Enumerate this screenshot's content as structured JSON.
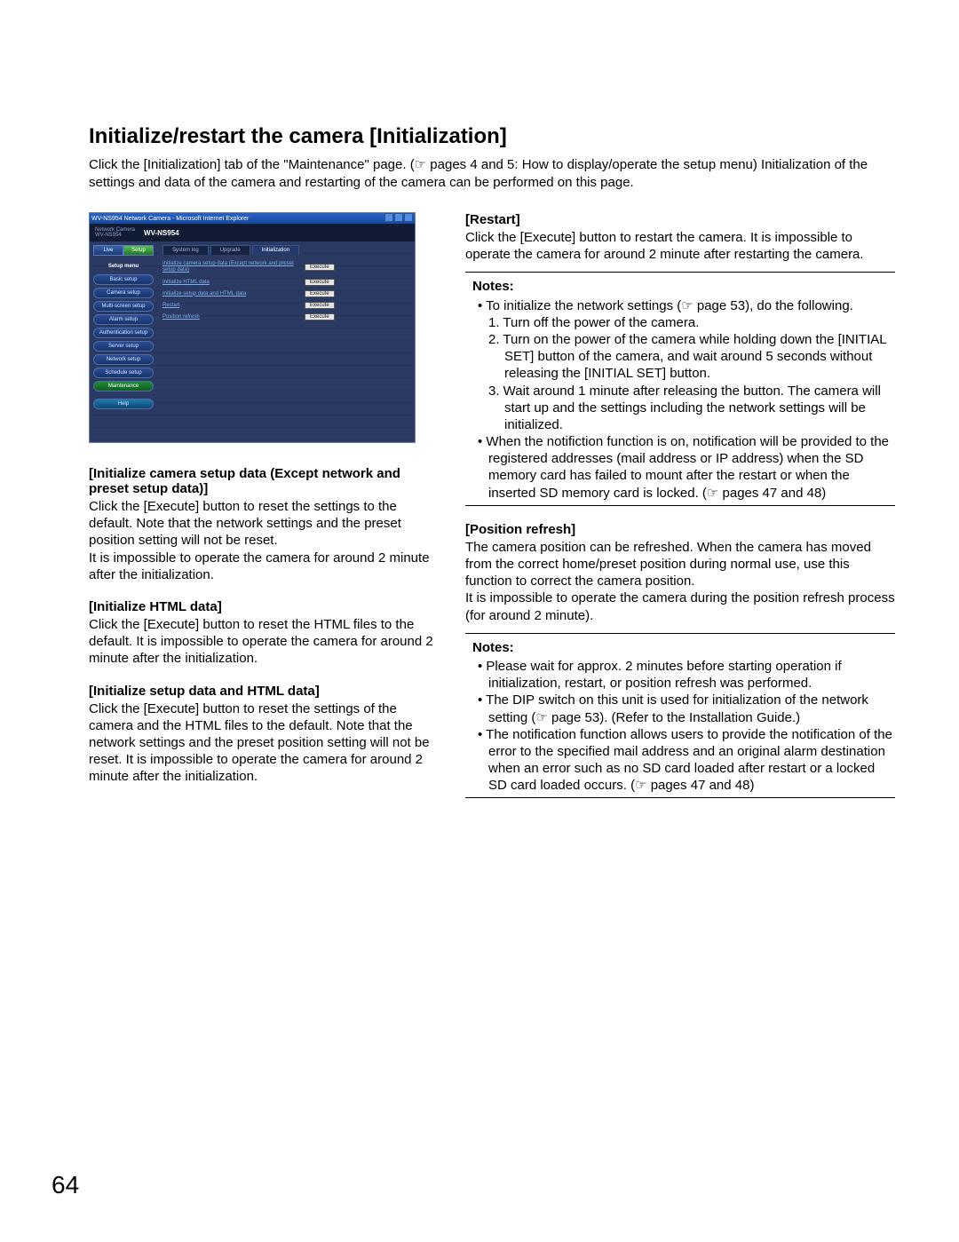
{
  "heading": "Initialize/restart the camera [Initialization]",
  "intro": "Click the [Initialization] tab of the \"Maintenance\" page. (☞ pages 4 and 5: How to display/operate the setup menu) Initialization of the settings and data of the camera and restarting of the camera can be performed on this page.",
  "screenshot": {
    "title": "WV-NS954 Network Camera - Microsoft Internet Explorer",
    "brand_small": "Network Camera",
    "brand_model": "WV-NS954",
    "model_big": "WV-NS954",
    "live_tab": "Live",
    "setup_tab": "Setup",
    "menu_head": "Setup menu",
    "sidebar": {
      "basic": "Basic setup",
      "camera": "Camera setup",
      "multi": "Multi-screen setup",
      "alarm": "Alarm setup",
      "auth": "Authentication setup",
      "server": "Server setup",
      "network": "Network setup",
      "schedule": "Schedule setup",
      "maint": "Maintenance",
      "help": "Help"
    },
    "tabs": {
      "log": "System log",
      "upgrade": "Upgrade",
      "init": "Initialization"
    },
    "rows": {
      "r1": "Initialize camera setup data (Except network and preset setup data)",
      "r2": "Initialize HTML data",
      "r3": "Initialize setup data and HTML data",
      "r4": "Restart",
      "r5": "Position refresh"
    },
    "exec": "Execute"
  },
  "left": {
    "t1": "[Initialize camera setup data (Except network and preset setup data)]",
    "p1": "Click the [Execute] button to reset the settings to the default. Note that the network settings and the preset position setting will not be reset.",
    "p1b": "It is impossible to operate the camera for around 2 minute after the initialization.",
    "t2": "[Initialize HTML data]",
    "p2": "Click the [Execute] button to reset the HTML files to the default. It is impossible to operate the camera for around 2 minute after the initialization.",
    "t3": "[Initialize setup data and HTML data]",
    "p3": "Click the [Execute] button to reset the settings of the camera and the HTML files to the default. Note that the network settings and the preset position setting will not be reset. It is impossible to operate the camera for around 2 minute after the initialization."
  },
  "right": {
    "t1": "[Restart]",
    "p1": "Click the [Execute] button to restart the camera. It is impossible to operate the camera for around 2 minute after restarting the camera.",
    "notes1_head": "Notes:",
    "notes1_b1": "To initialize the network settings (☞ page 53), do the following.",
    "notes1_n1": "1.  Turn off the power of the camera.",
    "notes1_n2": "2.  Turn on the power of the camera while holding down the [INITIAL SET] button of the camera, and wait around 5 seconds without releasing the [INITIAL SET] button.",
    "notes1_n3": "3.  Wait around 1 minute after releasing the button. The camera will start up and the settings including the network settings will be initialized.",
    "notes1_b2": "When the notifiction function is on, notification will be provided to the registered addresses (mail address or IP address) when the SD memory card has failed to mount after the restart or when the inserted SD memory card is locked. (☞ pages 47 and 48)",
    "t2": "[Position refresh]",
    "p2": "The camera position can be refreshed. When the camera has moved from the correct home/preset position during normal use, use this function to correct the camera position.",
    "p2b": "It is impossible to operate the camera during the position refresh process (for around 2 minute).",
    "notes2_head": "Notes:",
    "notes2_b1": "Please wait for approx. 2 minutes before starting operation if initialization, restart, or position refresh was performed.",
    "notes2_b2": "The DIP switch on this unit is used for initialization of the network setting (☞ page 53). (Refer to the Installation Guide.)",
    "notes2_b3": "The notification function allows users to provide the notification of the error to the specified mail address and an original alarm destination when an error such as no SD card loaded after restart or a locked SD card loaded occurs. (☞ pages 47 and 48)"
  },
  "page_number": "64"
}
